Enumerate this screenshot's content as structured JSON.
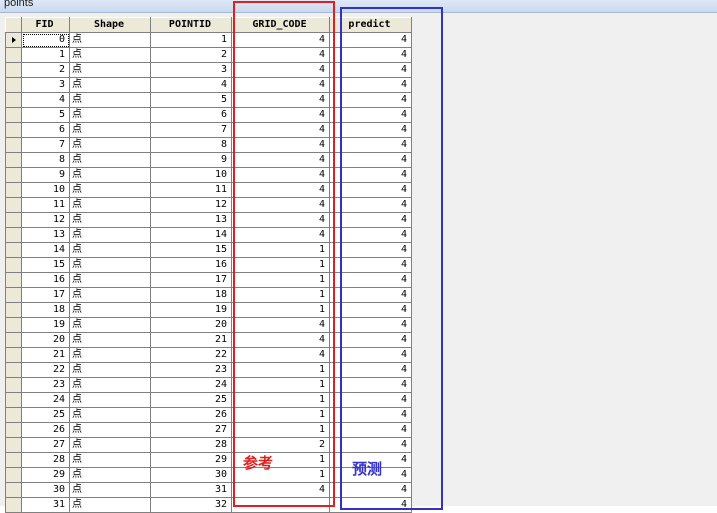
{
  "window": {
    "title": "points"
  },
  "columns": [
    "FID",
    "Shape",
    "POINTID",
    "GRID_CODE",
    "predict"
  ],
  "rows": [
    {
      "fid": "0",
      "shape": "点",
      "pointid": "1",
      "grid_code": "4",
      "predict": "4"
    },
    {
      "fid": "1",
      "shape": "点",
      "pointid": "2",
      "grid_code": "4",
      "predict": "4"
    },
    {
      "fid": "2",
      "shape": "点",
      "pointid": "3",
      "grid_code": "4",
      "predict": "4"
    },
    {
      "fid": "3",
      "shape": "点",
      "pointid": "4",
      "grid_code": "4",
      "predict": "4"
    },
    {
      "fid": "4",
      "shape": "点",
      "pointid": "5",
      "grid_code": "4",
      "predict": "4"
    },
    {
      "fid": "5",
      "shape": "点",
      "pointid": "6",
      "grid_code": "4",
      "predict": "4"
    },
    {
      "fid": "6",
      "shape": "点",
      "pointid": "7",
      "grid_code": "4",
      "predict": "4"
    },
    {
      "fid": "7",
      "shape": "点",
      "pointid": "8",
      "grid_code": "4",
      "predict": "4"
    },
    {
      "fid": "8",
      "shape": "点",
      "pointid": "9",
      "grid_code": "4",
      "predict": "4"
    },
    {
      "fid": "9",
      "shape": "点",
      "pointid": "10",
      "grid_code": "4",
      "predict": "4"
    },
    {
      "fid": "10",
      "shape": "点",
      "pointid": "11",
      "grid_code": "4",
      "predict": "4"
    },
    {
      "fid": "11",
      "shape": "点",
      "pointid": "12",
      "grid_code": "4",
      "predict": "4"
    },
    {
      "fid": "12",
      "shape": "点",
      "pointid": "13",
      "grid_code": "4",
      "predict": "4"
    },
    {
      "fid": "13",
      "shape": "点",
      "pointid": "14",
      "grid_code": "4",
      "predict": "4"
    },
    {
      "fid": "14",
      "shape": "点",
      "pointid": "15",
      "grid_code": "1",
      "predict": "4"
    },
    {
      "fid": "15",
      "shape": "点",
      "pointid": "16",
      "grid_code": "1",
      "predict": "4"
    },
    {
      "fid": "16",
      "shape": "点",
      "pointid": "17",
      "grid_code": "1",
      "predict": "4"
    },
    {
      "fid": "17",
      "shape": "点",
      "pointid": "18",
      "grid_code": "1",
      "predict": "4"
    },
    {
      "fid": "18",
      "shape": "点",
      "pointid": "19",
      "grid_code": "1",
      "predict": "4"
    },
    {
      "fid": "19",
      "shape": "点",
      "pointid": "20",
      "grid_code": "4",
      "predict": "4"
    },
    {
      "fid": "20",
      "shape": "点",
      "pointid": "21",
      "grid_code": "4",
      "predict": "4"
    },
    {
      "fid": "21",
      "shape": "点",
      "pointid": "22",
      "grid_code": "4",
      "predict": "4"
    },
    {
      "fid": "22",
      "shape": "点",
      "pointid": "23",
      "grid_code": "1",
      "predict": "4"
    },
    {
      "fid": "23",
      "shape": "点",
      "pointid": "24",
      "grid_code": "1",
      "predict": "4"
    },
    {
      "fid": "24",
      "shape": "点",
      "pointid": "25",
      "grid_code": "1",
      "predict": "4"
    },
    {
      "fid": "25",
      "shape": "点",
      "pointid": "26",
      "grid_code": "1",
      "predict": "4"
    },
    {
      "fid": "26",
      "shape": "点",
      "pointid": "27",
      "grid_code": "1",
      "predict": "4"
    },
    {
      "fid": "27",
      "shape": "点",
      "pointid": "28",
      "grid_code": "2",
      "predict": "4"
    },
    {
      "fid": "28",
      "shape": "点",
      "pointid": "29",
      "grid_code": "1",
      "predict": "4"
    },
    {
      "fid": "29",
      "shape": "点",
      "pointid": "30",
      "grid_code": "1",
      "predict": "4"
    },
    {
      "fid": "30",
      "shape": "点",
      "pointid": "31",
      "grid_code": "4",
      "predict": "4"
    },
    {
      "fid": "31",
      "shape": "点",
      "pointid": "32",
      "grid_code": "",
      "predict": "4"
    }
  ],
  "active_row_index": 0,
  "annotations": {
    "reference_label": "参考",
    "predict_label": "预测",
    "reference_color": "#e02020",
    "predict_color": "#3232c8"
  }
}
